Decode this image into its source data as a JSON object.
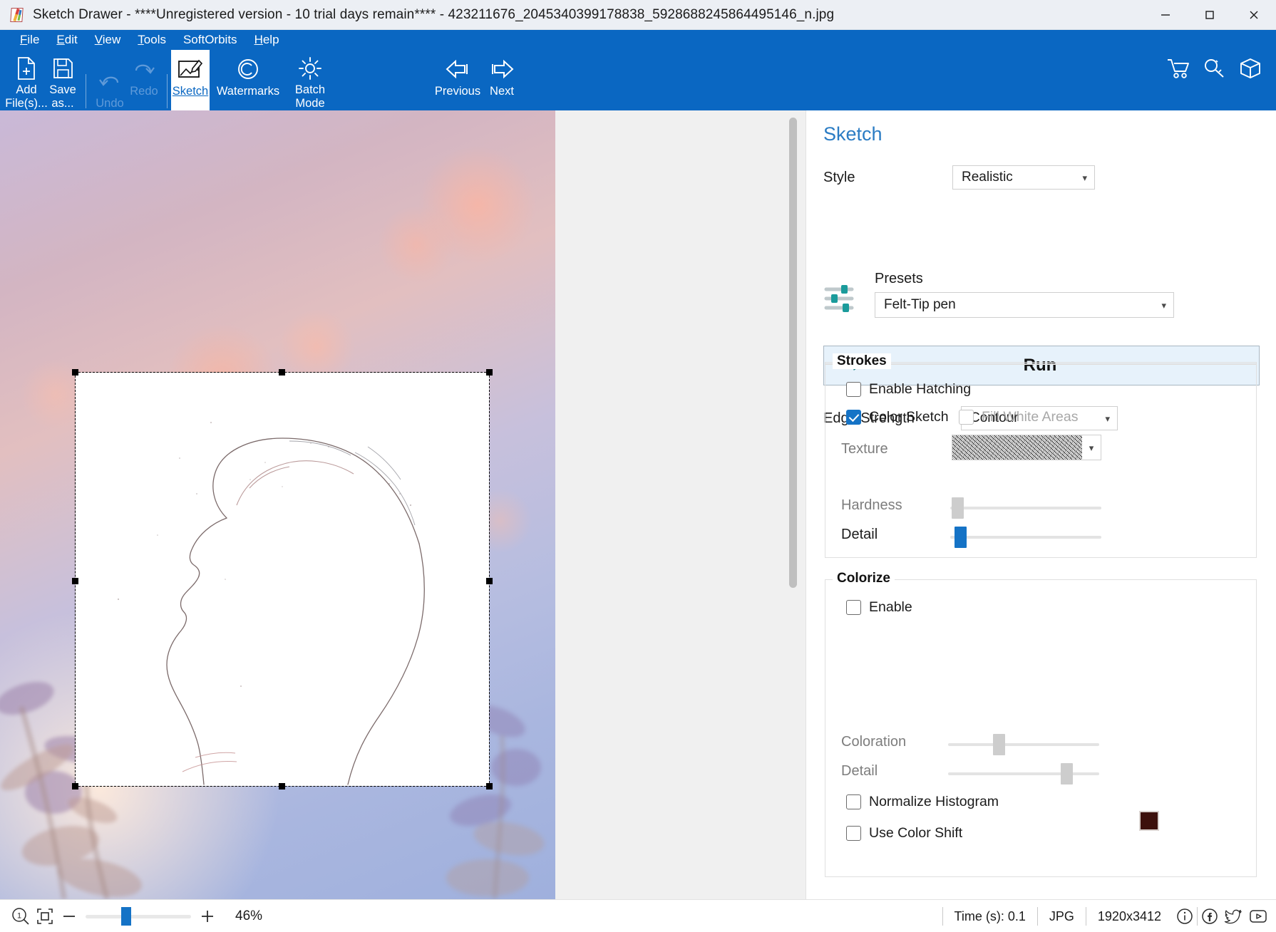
{
  "window": {
    "title": "Sketch Drawer - ****Unregistered version - 10 trial days remain**** - 423211676_2045340399178838_5928688245864495146_n.jpg",
    "app_icon": "sketch-drawer-logo",
    "minimize_label": "Minimize",
    "maximize_label": "Maximize",
    "close_label": "Close"
  },
  "menubar": {
    "items": [
      {
        "label": "File",
        "accel": "F"
      },
      {
        "label": "Edit",
        "accel": "E"
      },
      {
        "label": "View",
        "accel": "V"
      },
      {
        "label": "Tools",
        "accel": "T"
      },
      {
        "label": "SoftOrbits",
        "accel": ""
      },
      {
        "label": "Help",
        "accel": "H"
      }
    ]
  },
  "toolbar": {
    "items": [
      {
        "name": "add-files",
        "label": "Add\nFile(s)...",
        "icon": "document-plus-icon",
        "state": "normal"
      },
      {
        "name": "save-as",
        "label": "Save\nas...",
        "icon": "floppy-disk-icon",
        "state": "normal"
      },
      {
        "name": "undo",
        "label": "Undo",
        "icon": "undo-arrow-icon",
        "state": "disabled"
      },
      {
        "name": "redo",
        "label": "Redo",
        "icon": "redo-arrow-icon",
        "state": "disabled"
      },
      {
        "name": "sketch",
        "label": "Sketch",
        "icon": "sketch-picture-pencil-icon",
        "state": "selected"
      },
      {
        "name": "watermarks",
        "label": "Watermarks",
        "icon": "copyright-icon",
        "state": "normal"
      },
      {
        "name": "batch-mode",
        "label": "Batch\nMode",
        "icon": "gear-icon",
        "state": "normal"
      },
      {
        "name": "previous",
        "label": "Previous",
        "icon": "arrow-left-icon",
        "state": "normal"
      },
      {
        "name": "next",
        "label": "Next",
        "icon": "arrow-right-icon",
        "state": "normal"
      }
    ],
    "right_icons": [
      {
        "name": "buy-cart",
        "icon": "shopping-cart-icon"
      },
      {
        "name": "register-key",
        "icon": "key-icon"
      },
      {
        "name": "products-box",
        "icon": "box-icon"
      }
    ]
  },
  "panel": {
    "title": "Sketch",
    "style": {
      "label": "Style",
      "value": "Realistic"
    },
    "presets": {
      "label": "Presets",
      "value": "Felt-Tip pen",
      "icon": "sliders-icon"
    },
    "run": {
      "label": "Run",
      "icon": "arrow-right-thick-icon"
    },
    "edge_strength": {
      "label": "Edge Strength",
      "value": "Contour"
    },
    "strokes": {
      "caption": "Strokes",
      "enable_hatching": {
        "label": "Enable Hatching",
        "checked": false,
        "disabled": false
      },
      "color_sketch": {
        "label": "Color Sketch",
        "checked": true,
        "disabled": false
      },
      "fill_white_areas": {
        "label": "Fill White Areas",
        "checked": false,
        "disabled": true
      },
      "texture": {
        "label": "Texture",
        "value": "pencil-hatch-texture",
        "disabled": true
      },
      "hardness": {
        "label": "Hardness",
        "value": 3,
        "min": 0,
        "max": 100,
        "disabled": true
      },
      "detail": {
        "label": "Detail",
        "value": 4,
        "min": 0,
        "max": 100,
        "disabled": false
      }
    },
    "colorize": {
      "caption": "Colorize",
      "enable": {
        "label": "Enable",
        "checked": false,
        "disabled": false
      },
      "coloration": {
        "label": "Coloration",
        "value": 31,
        "min": 0,
        "max": 100,
        "disabled": true
      },
      "detail": {
        "label": "Detail",
        "value": 76,
        "min": 0,
        "max": 100,
        "disabled": true
      },
      "normalize_histogram": {
        "label": "Normalize Histogram",
        "checked": false,
        "disabled": false
      },
      "use_color_shift": {
        "label": "Use Color Shift",
        "checked": false,
        "disabled": false
      },
      "color_swatch": "#3c100c"
    }
  },
  "statusbar": {
    "zoom_reset_icon": "magnifier-one-icon",
    "fit_icon": "fit-to-window-icon",
    "zoom_out_icon": "minus-icon",
    "zoom_in_icon": "plus-icon",
    "zoom_percent": "46%",
    "zoom_value": 46,
    "time": "Time (s): 0.1",
    "format": "JPG",
    "dimensions": "1920x3412",
    "icons": [
      {
        "name": "info-icon",
        "glyph": "info"
      },
      {
        "name": "facebook-icon",
        "glyph": "facebook"
      },
      {
        "name": "twitter-icon",
        "glyph": "twitter"
      },
      {
        "name": "youtube-icon",
        "glyph": "youtube"
      }
    ]
  },
  "canvas": {
    "selection_label": "image-selection",
    "image_alt": "bokeh-photo-with-sketch-overlay"
  },
  "colors": {
    "ribbon_blue": "#0a67c2",
    "accent_blue": "#1573c6",
    "panel_title": "#2b7cc4",
    "teal": "#1a9b9b"
  }
}
